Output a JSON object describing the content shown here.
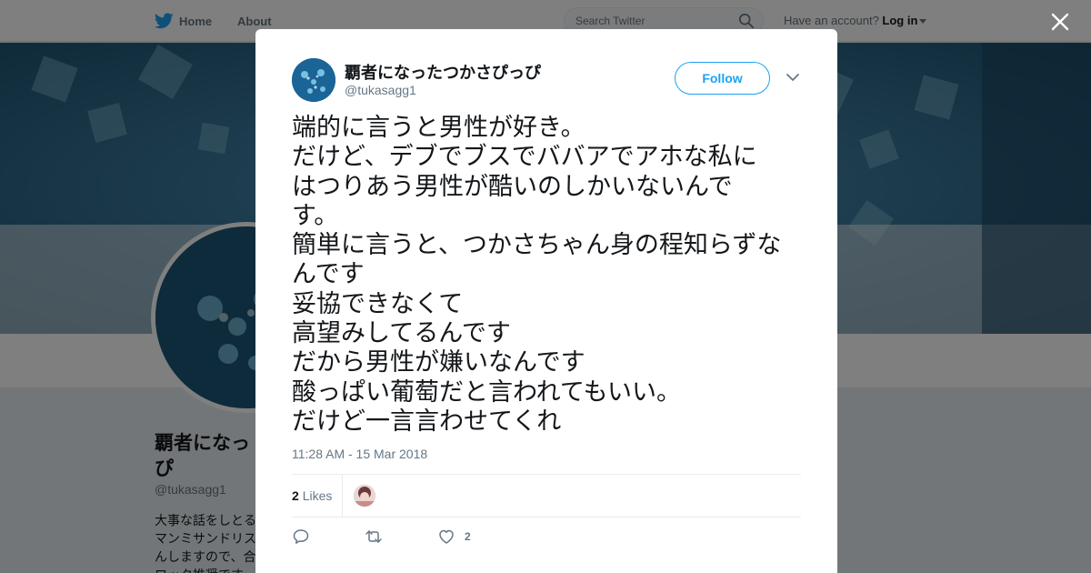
{
  "nav": {
    "home_label": "Home",
    "about_label": "About",
    "search_placeholder": "Search Twitter",
    "account_prompt": "Have an account?",
    "login_label": "Log in"
  },
  "profile": {
    "name_line1": "覇者になっ",
    "name_line2": "ぴ",
    "handle": "@tukasagg1",
    "bio_lines": [
      "大事な話をしとる",
      "マンミサンドリス",
      "んしますので、合",
      "ロック推奨です"
    ]
  },
  "tweet": {
    "author_name": "覇者になったつかさぴっぴ",
    "author_handle": "@tukasagg1",
    "follow_label": "Follow",
    "lines": [
      "端的に言うと男性が好き。",
      "だけど、デブでブスでババアでアホな私に",
      "はつりあう男性が酷いのしかいないんで",
      "す。",
      "簡単に言うと、つかさちゃん身の程知らずな",
      "んです",
      "妥協できなくて",
      "高望みしてるんです",
      "だから男性が嫌いなんです",
      "酸っぱい葡萄だと言われてもいい。",
      "だけど一言言わせてくれ"
    ],
    "timestamp": "11:28 AM - 15 Mar 2018",
    "likes_count": "2",
    "likes_label": "Likes",
    "action_like_count": "2"
  },
  "colors": {
    "accent": "#1da1f2",
    "text_primary": "#14171a",
    "text_secondary": "#657786",
    "like_heart": "#657786"
  },
  "icons": [
    "twitter-bird-icon",
    "search-icon",
    "close-icon",
    "chevron-down-icon",
    "reply-icon",
    "retweet-icon",
    "heart-icon"
  ]
}
